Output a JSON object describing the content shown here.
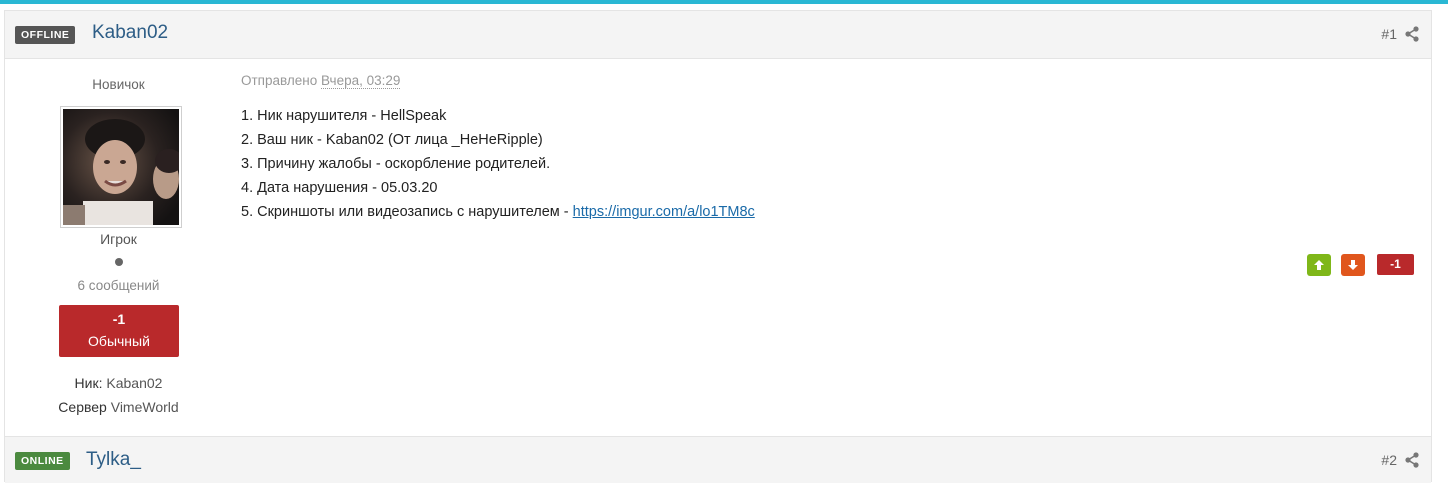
{
  "colors": {
    "accent_bar": "#2ab8d4",
    "username": "#2d5d86",
    "reputation_negative": "#b9292b",
    "vote_up": "#7fb719",
    "vote_down": "#e0561d",
    "link": "#1a6aa8"
  },
  "posts": [
    {
      "status_badge": "OFFLINE",
      "username": "Kaban02",
      "post_number": "#1",
      "author": {
        "rank": "Новичок",
        "group": "Игрок",
        "post_count": "6 сообщений",
        "reputation_value": "-1",
        "reputation_label": "Обычный",
        "nick_label": "Ник:",
        "nick_value": "Kaban02",
        "server_label": "Сервер",
        "server_value": "VimeWorld"
      },
      "posted_label": "Отправлено",
      "posted_date": "Вчера, 03:29",
      "lines": [
        "1. Ник нарушителя - HellSpeak",
        "2. Ваш ник - Kaban02 (От лица _HeHeRipple)",
        "3. Причину жалобы - оскорбление родителей.",
        "4. Дата нарушения - 05.03.20"
      ],
      "line5_text": "5. Скриншоты или видеозапись с нарушителем - ",
      "line5_link": "https://imgur.com/a/lo1TM8c",
      "post_reputation": "-1",
      "icons": [
        "share-icon",
        "arrow-up-icon",
        "arrow-down-icon"
      ]
    },
    {
      "status_badge": "ONLINE",
      "username": "Tylka_",
      "post_number": "#2",
      "icons": [
        "share-icon"
      ]
    }
  ]
}
